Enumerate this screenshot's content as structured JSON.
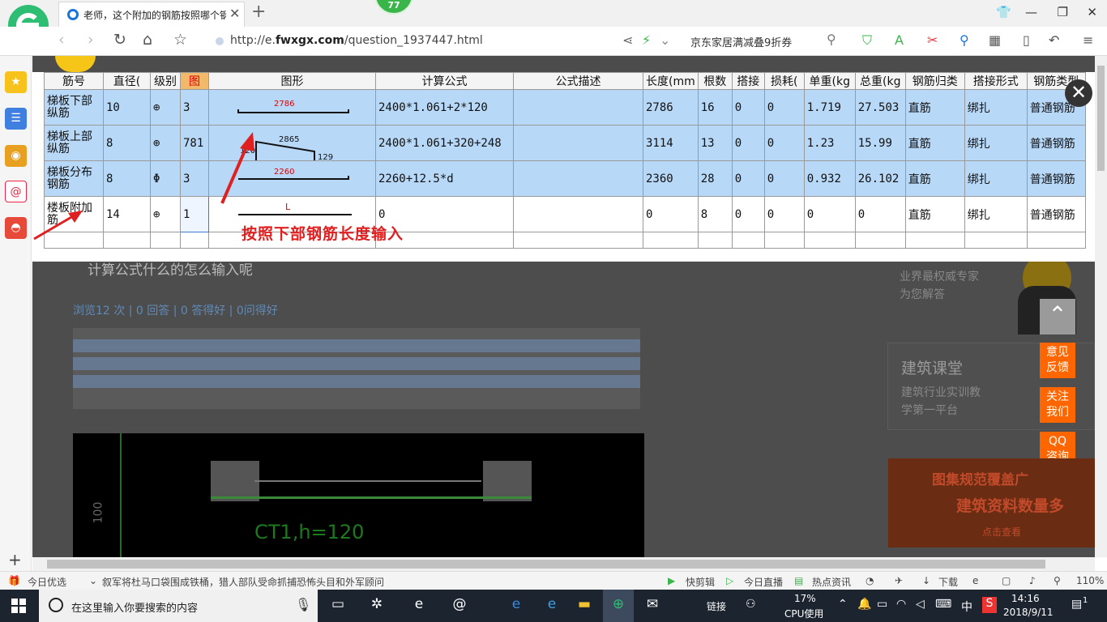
{
  "browser": {
    "tab_title": "老师，这个附加的钢筋按照哪个钢",
    "badge_count": "77",
    "url_prefix": "http://e.",
    "url_domain": "fwxgx.com",
    "url_path": "/question_1937447.html",
    "ad_text": "京东家居满减叠9折券"
  },
  "table": {
    "headers": [
      "筋号",
      "直径(",
      "级别",
      "图",
      "图形",
      "计算公式",
      "公式描述",
      "长度(mm",
      "根数",
      "搭接",
      "损耗(",
      "单重(kg",
      "总重(kg",
      "钢筋归类",
      "搭接形式",
      "钢筋类型"
    ],
    "rows": [
      {
        "name": "梯板下部纵筋",
        "diameter": "10",
        "grade": "⊕",
        "fig": "3",
        "shape_label": "2786",
        "formula": "2400*1.061+2*120",
        "desc": "",
        "length": "2786",
        "count": "16",
        "lap": "0",
        "loss": "0",
        "unit_w": "1.719",
        "total_w": "27.503",
        "category": "直筋",
        "lap_type": "绑扎",
        "type": "普通钢筋"
      },
      {
        "name": "梯板上部纵筋",
        "diameter": "8",
        "grade": "⊕",
        "fig": "781",
        "shape_label": "2865",
        "shape_left": "120",
        "shape_right": "129",
        "formula": "2400*1.061+320+248",
        "desc": "",
        "length": "3114",
        "count": "13",
        "lap": "0",
        "loss": "0",
        "unit_w": "1.23",
        "total_w": "15.99",
        "category": "直筋",
        "lap_type": "绑扎",
        "type": "普通钢筋"
      },
      {
        "name": "梯板分布钢筋",
        "diameter": "8",
        "grade": "Φ",
        "fig": "3",
        "shape_label": "2260",
        "formula": "2260+12.5*d",
        "desc": "",
        "length": "2360",
        "count": "28",
        "lap": "0",
        "loss": "0",
        "unit_w": "0.932",
        "total_w": "26.102",
        "category": "直筋",
        "lap_type": "绑扎",
        "type": "普通钢筋"
      },
      {
        "name": "楼板附加筋",
        "diameter": "14",
        "grade": "⊕",
        "fig": "1",
        "shape_label": "L",
        "formula": "0",
        "desc": "",
        "length": "0",
        "count": "8",
        "lap": "0",
        "loss": "0",
        "unit_w": "0",
        "total_w": "0",
        "category": "直筋",
        "lap_type": "绑扎",
        "type": "普通钢筋"
      }
    ],
    "annotation": "按照下部钢筋长度输入"
  },
  "background": {
    "question_title": "计算公式什么的怎么输入呢",
    "stats": "浏览12 次 | 0 回答 | 0 答得好 | 0问得好",
    "expert_line1": "业界最权威专家",
    "expert_line2": "为您解答",
    "course_title": "建筑课堂",
    "course_line1": "建筑行业实训教",
    "course_line2": "学第一平台",
    "banner_line1": "图集规范覆盖广",
    "banner_line2": "建筑资料数量多",
    "banner_link": "点击查看",
    "cad_label1": "100",
    "cad_label2": "CT1,h=120",
    "feedback": "意见反馈",
    "follow": "关注我们",
    "qq": "QQ咨询"
  },
  "statusbar": {
    "today": "今日优选",
    "news": "叙军将杜马口袋围成铁桶，猎人部队受命抓捕恐怖头目和外军顾问",
    "kuaijianji": "快剪辑",
    "live": "今日直播",
    "hot": "热点资讯",
    "download": "下载",
    "zoom": "110%"
  },
  "taskbar": {
    "search_placeholder": "在这里输入你要搜索的内容",
    "link": "链接",
    "cpu_pct": "17%",
    "cpu_label": "CPU使用",
    "ime": "中",
    "time": "14:16",
    "date": "2018/9/11",
    "notif": "1"
  }
}
